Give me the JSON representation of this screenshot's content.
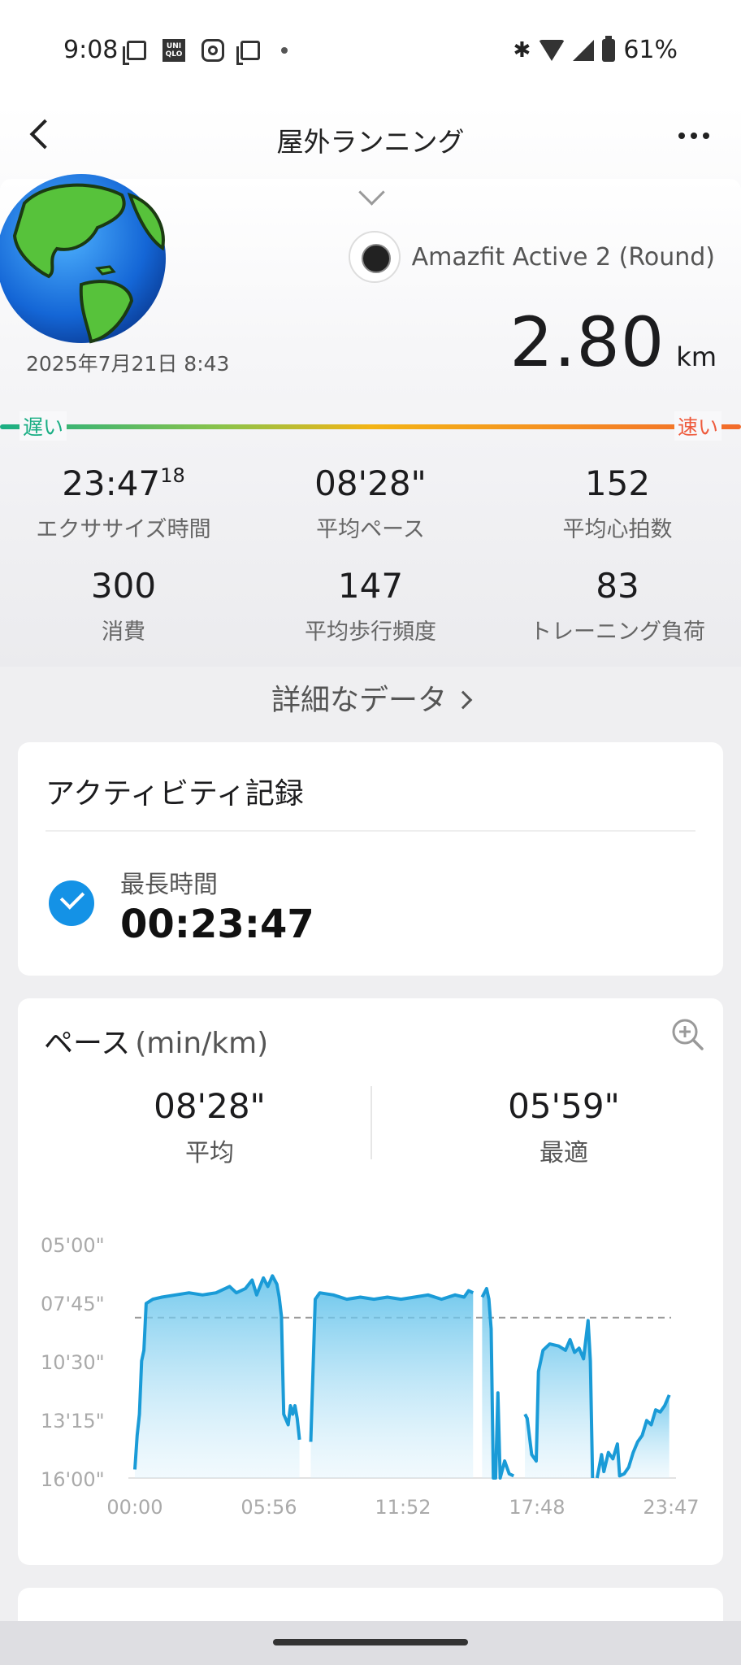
{
  "status_bar": {
    "time": "9:08",
    "battery": "61%",
    "icons": [
      "screenshot-icon",
      "uniqlo-icon",
      "instagram-icon",
      "screenshot-icon",
      "dot-icon",
      "bluetooth-icon",
      "wifi-icon",
      "signal-icon",
      "battery-icon"
    ]
  },
  "header": {
    "title": "屋外ランニング"
  },
  "activity": {
    "date": "2025年7月21日 8:43",
    "device": "Amazfit Active 2 (Round)",
    "distance_value": "2.80",
    "distance_unit": "km",
    "slow_label": "遅い",
    "fast_label": "速い"
  },
  "stats": [
    {
      "value": "23:47",
      "sup": "18",
      "label": "エクササイズ時間"
    },
    {
      "value": "08'28\"",
      "sup": "",
      "label": "平均ペース"
    },
    {
      "value": "152",
      "sup": "",
      "label": "平均心拍数"
    },
    {
      "value": "300",
      "sup": "",
      "label": "消費"
    },
    {
      "value": "147",
      "sup": "",
      "label": "平均歩行頻度"
    },
    {
      "value": "83",
      "sup": "",
      "label": "トレーニング負荷"
    }
  ],
  "detail_link": "詳細なデータ",
  "record_card": {
    "title": "アクティビティ記録",
    "label": "最長時間",
    "value": "00:23:47"
  },
  "pace_card": {
    "title": "ペース",
    "unit": "(min/km)",
    "avg_value": "08'28\"",
    "avg_label": "平均",
    "best_value": "05'59\"",
    "best_label": "最適"
  },
  "chart_data": {
    "type": "area",
    "y_tick_labels": [
      "05'00\"",
      "07'45\"",
      "10'30\"",
      "13'15\"",
      "16'00\""
    ],
    "x_tick_labels": [
      "00:00",
      "05:56",
      "11:52",
      "17:48",
      "23:47"
    ],
    "y_reversed": true,
    "average_line": "08'28\"",
    "color": "#1a9bd7",
    "segments": [
      [
        [
          0.0,
          15.6
        ],
        [
          0.1,
          14.0
        ],
        [
          0.2,
          13.0
        ],
        [
          0.3,
          10.5
        ],
        [
          0.4,
          10.0
        ],
        [
          0.5,
          7.8
        ],
        [
          0.8,
          7.6
        ],
        [
          1.2,
          7.5
        ],
        [
          1.8,
          7.4
        ],
        [
          2.4,
          7.3
        ],
        [
          3.0,
          7.4
        ],
        [
          3.6,
          7.3
        ],
        [
          4.2,
          7.0
        ],
        [
          4.5,
          7.3
        ],
        [
          4.9,
          7.1
        ],
        [
          5.2,
          6.7
        ],
        [
          5.4,
          7.4
        ],
        [
          5.7,
          6.6
        ],
        [
          5.9,
          7.0
        ],
        [
          6.1,
          6.5
        ],
        [
          6.3,
          6.9
        ],
        [
          6.4,
          7.5
        ],
        [
          6.5,
          8.4
        ],
        [
          6.6,
          13.0
        ],
        [
          6.8,
          13.5
        ],
        [
          6.9,
          12.6
        ],
        [
          7.0,
          13.0
        ],
        [
          7.1,
          12.6
        ],
        [
          7.2,
          13.2
        ],
        [
          7.3,
          14.2
        ]
      ],
      [
        [
          7.8,
          14.3
        ],
        [
          7.9,
          11.0
        ],
        [
          8.0,
          7.6
        ],
        [
          8.2,
          7.3
        ],
        [
          8.8,
          7.4
        ],
        [
          9.4,
          7.6
        ],
        [
          10.0,
          7.5
        ],
        [
          10.6,
          7.6
        ],
        [
          11.2,
          7.5
        ],
        [
          11.8,
          7.6
        ],
        [
          12.4,
          7.5
        ],
        [
          13.0,
          7.4
        ],
        [
          13.6,
          7.6
        ],
        [
          14.2,
          7.4
        ],
        [
          14.6,
          7.5
        ],
        [
          14.8,
          7.2
        ],
        [
          15.0,
          7.3
        ]
      ],
      [
        [
          15.4,
          7.5
        ],
        [
          15.6,
          7.1
        ],
        [
          15.7,
          7.6
        ],
        [
          15.8,
          9.0
        ],
        [
          15.9,
          16.0
        ],
        [
          16.0,
          16.0
        ],
        [
          16.1,
          12.0
        ],
        [
          16.2,
          16.0
        ],
        [
          16.4,
          15.2
        ],
        [
          16.6,
          15.8
        ],
        [
          16.8,
          15.9
        ]
      ],
      [
        [
          17.3,
          13.0
        ],
        [
          17.4,
          13.2
        ],
        [
          17.6,
          14.9
        ],
        [
          17.8,
          15.2
        ],
        [
          17.9,
          11.0
        ],
        [
          18.1,
          10.0
        ],
        [
          18.4,
          9.7
        ],
        [
          18.8,
          9.8
        ],
        [
          19.1,
          10.0
        ],
        [
          19.3,
          9.5
        ],
        [
          19.5,
          10.1
        ],
        [
          19.7,
          9.9
        ],
        [
          19.9,
          10.4
        ],
        [
          20.1,
          8.6
        ],
        [
          20.2,
          10.5
        ],
        [
          20.3,
          16.0
        ]
      ],
      [
        [
          20.5,
          16.0
        ],
        [
          20.7,
          14.9
        ],
        [
          20.8,
          15.7
        ],
        [
          21.0,
          14.8
        ],
        [
          21.2,
          15.1
        ],
        [
          21.4,
          14.4
        ],
        [
          21.5,
          15.9
        ],
        [
          21.7,
          15.8
        ],
        [
          21.9,
          15.5
        ],
        [
          22.1,
          14.8
        ],
        [
          22.3,
          14.3
        ],
        [
          22.5,
          14.0
        ],
        [
          22.7,
          13.3
        ],
        [
          22.9,
          13.5
        ],
        [
          23.1,
          12.8
        ],
        [
          23.3,
          12.9
        ],
        [
          23.5,
          12.6
        ],
        [
          23.7,
          12.1
        ]
      ]
    ]
  }
}
